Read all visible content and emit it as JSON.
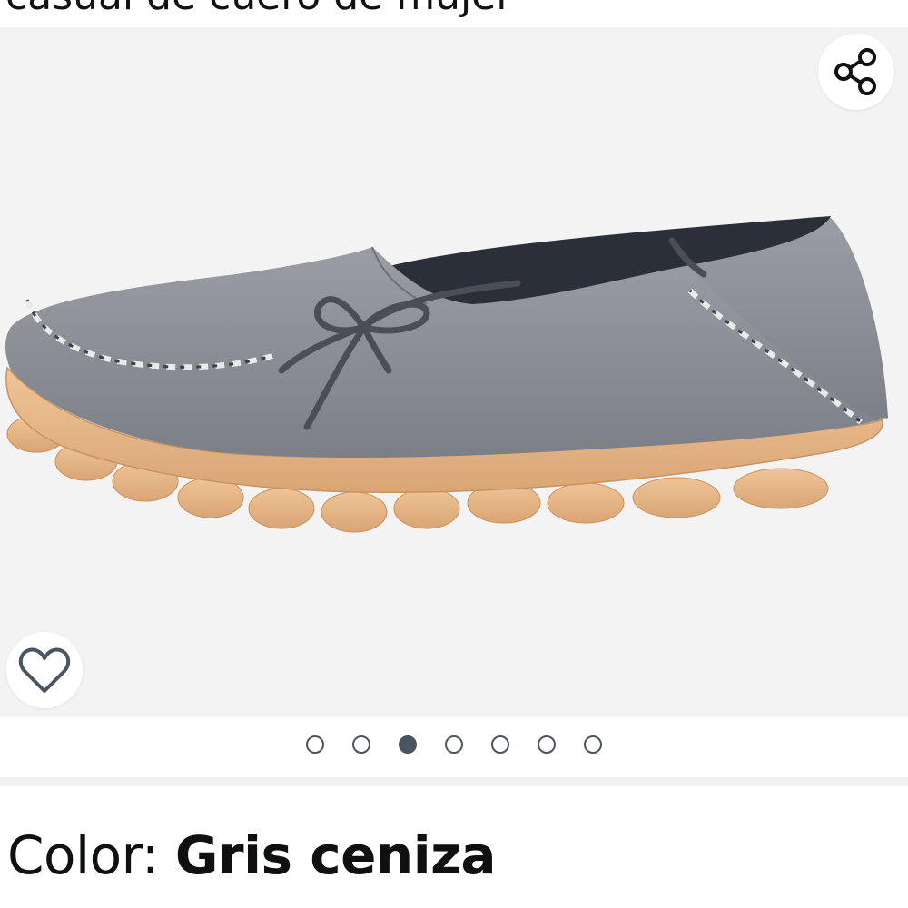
{
  "header": {
    "clipped_title": "casual de cuero de mujer"
  },
  "gallery": {
    "image_label": "grey leather loafer with lace bow and gum sole",
    "share_icon": "share-icon",
    "wishlist_icon": "heart-outline-icon",
    "image_count": 7,
    "active_index": 3
  },
  "variation": {
    "label": "Color: ",
    "value": "Gris ceniza"
  },
  "colors": {
    "shoe_upper": "#8a8e94",
    "sole": "#e6b88a",
    "lace": "#4b4f55",
    "lining": "#2b2f3a",
    "dot": "#4a5560"
  }
}
